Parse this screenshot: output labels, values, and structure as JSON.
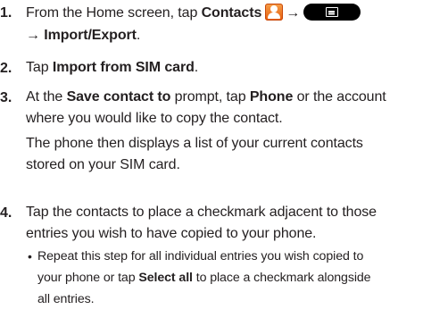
{
  "steps": [
    {
      "number": "1.",
      "line1_a": "From the Home screen, tap ",
      "line1_b": "Contacts",
      "arrow": "→",
      "line2_arrow": "→",
      "line2_b": "Import/Export",
      "line2_end": "."
    },
    {
      "number": "2.",
      "text_a": "Tap ",
      "text_b": "Import from SIM card",
      "text_end": "."
    },
    {
      "number": "3.",
      "line1_a": "At the ",
      "line1_b": "Save contact to",
      "line1_c": " prompt, tap ",
      "line1_d": "Phone",
      "line1_e": " or the account",
      "line2": "where you would like to copy the contact.",
      "line3": "The phone then displays a list of your current contacts",
      "line4": "stored on your SIM card."
    },
    {
      "number": "4.",
      "line1": "Tap the contacts to place a checkmark adjacent to those",
      "line2": "entries you wish to have copied to your phone.",
      "bullet": "•",
      "sub1": "Repeat this step for all individual entries you wish copied to",
      "sub2_a": "your phone or tap ",
      "sub2_b": "Select all",
      "sub2_c": " to place a checkmark alongside",
      "sub3": "all entries."
    }
  ],
  "icons": {
    "contacts": "contacts-app-icon",
    "menu": "menu-key-icon"
  },
  "colors": {
    "text": "#231f20",
    "contacts_icon": "#e65c0c",
    "menu_key": "#000000"
  }
}
